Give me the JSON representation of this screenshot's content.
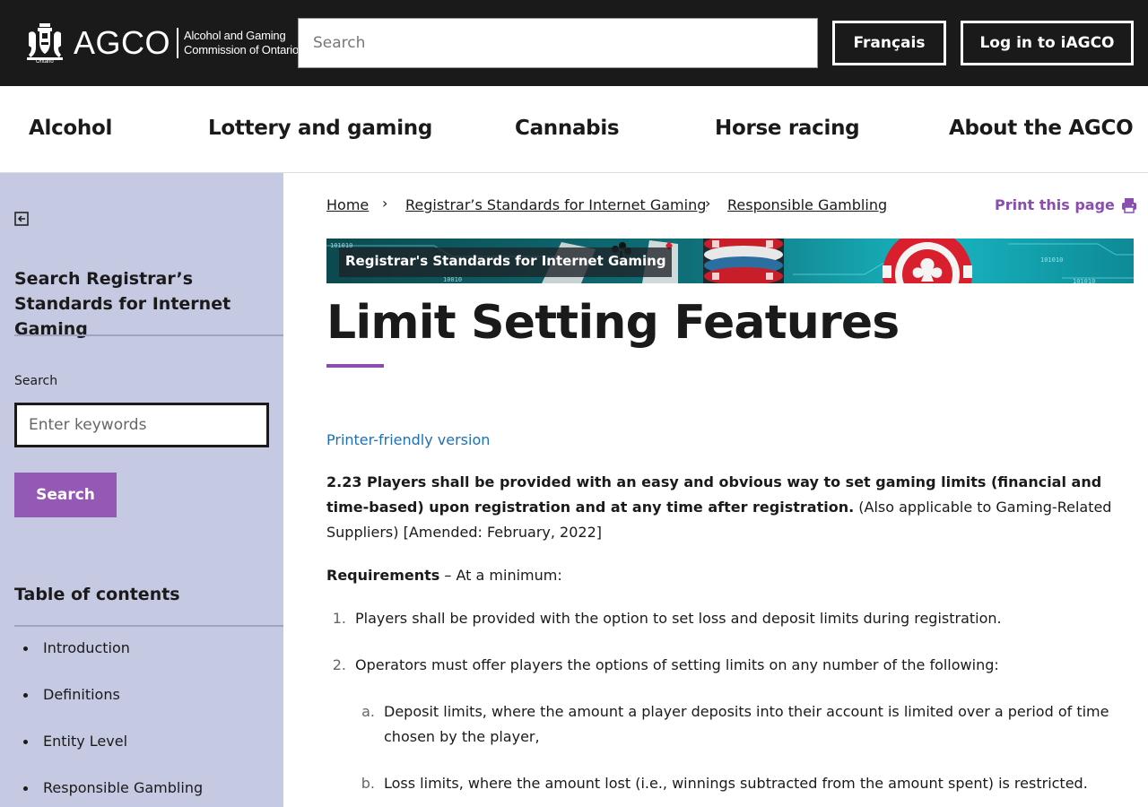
{
  "header": {
    "logo_word": "AGCO",
    "logo_sub_line1": "Alcohol and Gaming",
    "logo_sub_line2": "Commission of Ontario",
    "logo_tag": "Ontario",
    "search_placeholder": "Search",
    "french_label": "Français",
    "login_label": "Log in to iAGCO"
  },
  "nav": {
    "items": [
      "Alcohol",
      "Lottery and gaming",
      "Cannabis",
      "Horse racing",
      "About the AGCO"
    ]
  },
  "sidebar": {
    "heading": "Search Registrar’s Standards for Internet Gaming",
    "search_label": "Search",
    "search_placeholder": "Enter keywords",
    "search_button": "Search",
    "toc_heading": "Table of contents",
    "toc": [
      "Introduction",
      "Definitions",
      "Entity Level",
      "Responsible Gambling"
    ]
  },
  "breadcrumb": {
    "items": [
      "Home",
      "Registrar’s Standards for Internet Gaming",
      "Responsible Gambling"
    ],
    "separator": "›"
  },
  "print_label": "Print this page",
  "banner": {
    "label": "Registrar's Standards for Internet Gaming"
  },
  "page": {
    "title": "Limit Setting Features",
    "printer_friendly": "Printer-friendly version",
    "standard_bold": "2.23 Players shall be provided with an easy and obvious way to set gaming limits (financial and time-based) upon registration and at any time after registration.",
    "standard_rest": " (Also applicable to Gaming-Related Suppliers) [Amended: February, 2022]",
    "requirements_bold": "Requirements",
    "requirements_rest": " – At a minimum:",
    "list": [
      {
        "marker": "1.",
        "text": "Players shall be provided with the option to set loss and deposit limits during registration."
      },
      {
        "marker": "2.",
        "text": "Operators must offer players the options of setting limits on any number of the following:"
      }
    ],
    "sublist": [
      {
        "marker": "a.",
        "text": "Deposit limits, where the amount a player deposits into their account is limited over a period of time chosen by the player,"
      },
      {
        "marker": "b.",
        "text": "Loss limits, where the amount lost (i.e., winnings subtracted from the amount spent) is restricted."
      }
    ]
  },
  "colors": {
    "header_bg": "#1a1a1a",
    "sidebar_bg": "#c5c9e2",
    "accent_purple": "#9459b4",
    "link_blue": "#1f6fb2"
  },
  "icons": {
    "collapse": "collapse-sidebar-icon",
    "print": "printer-icon",
    "crest": "ontario-crest-icon"
  }
}
